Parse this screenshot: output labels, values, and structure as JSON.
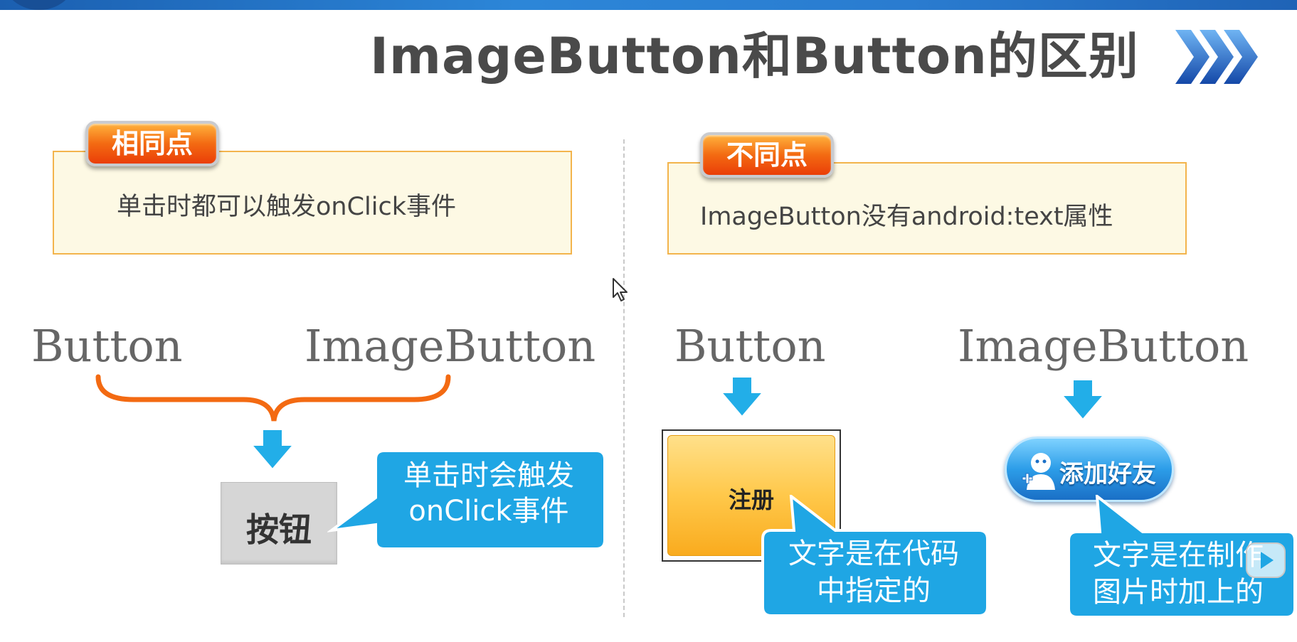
{
  "slide": {
    "title": "ImageButton和Button的区别",
    "colors": {
      "accent_blue": "#1fa6e4",
      "accent_orange": "#f36a12",
      "box_fill": "#fdf9e4",
      "box_border": "#f3b44c",
      "top_bar": "#2c86d8"
    }
  },
  "left": {
    "tag": "相同点",
    "description": "单击时都可以触发onClick事件",
    "label_button": "Button",
    "label_imagebutton": "ImageButton",
    "sample_button_text": "按钮",
    "callout_line1": "单击时会触发",
    "callout_line2": "onClick事件"
  },
  "right": {
    "tag": "不同点",
    "description": "ImageButton没有android:text属性",
    "label_button": "Button",
    "label_imagebutton": "ImageButton",
    "register_button_text": "注册",
    "add_friend_text": "添加好友",
    "callout1_line1": "文字是在代码",
    "callout1_line2": "中指定的",
    "callout2_line1": "文字是在制作",
    "callout2_line2": "图片时加上的"
  },
  "icons": {
    "chevrons": "chevron-right-triple-icon",
    "down_arrow": "arrow-down-icon",
    "brace": "curly-brace-icon",
    "avatar": "add-user-icon",
    "play": "play-icon",
    "cursor": "mouse-cursor-icon"
  }
}
